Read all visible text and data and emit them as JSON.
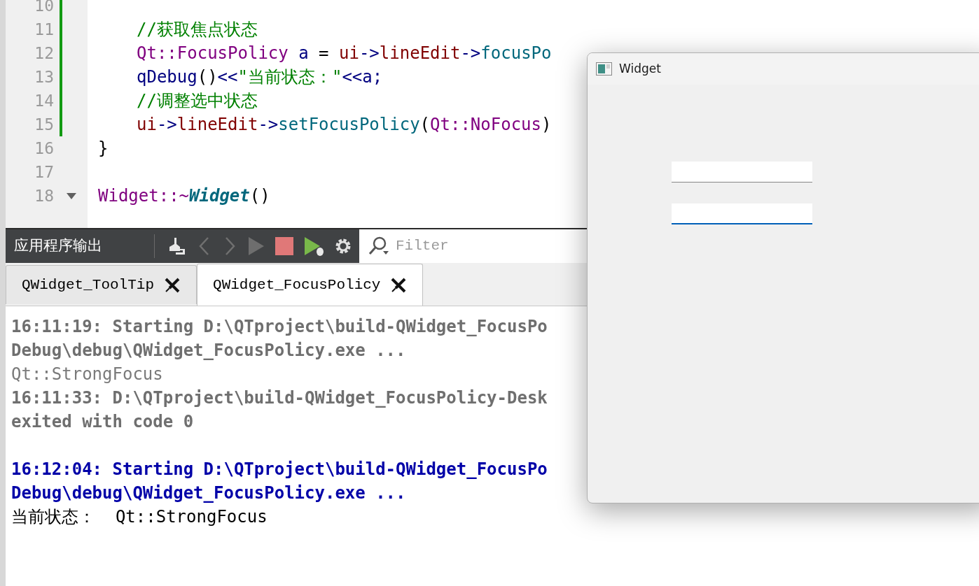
{
  "editor": {
    "lines": [
      {
        "number": "10",
        "changed": true
      },
      {
        "number": "11",
        "changed": true,
        "indented": true,
        "tokens": [
          {
            "kind": "comment",
            "text": "//获取焦点状态"
          }
        ]
      },
      {
        "number": "12",
        "changed": true,
        "indented": true,
        "tokens": [
          {
            "kind": "type",
            "text": "Qt::FocusPolicy"
          },
          {
            "kind": "local",
            "text": " a"
          },
          {
            "kind": "plain",
            "text": " = "
          },
          {
            "kind": "member",
            "text": "ui"
          },
          {
            "kind": "local",
            "text": "->"
          },
          {
            "kind": "member",
            "text": "lineEdit"
          },
          {
            "kind": "local",
            "text": "->"
          },
          {
            "kind": "func",
            "text": "focusPo"
          }
        ]
      },
      {
        "number": "13",
        "changed": true,
        "indented": true,
        "tokens": [
          {
            "kind": "local",
            "text": "qDebug"
          },
          {
            "kind": "plain",
            "text": "()"
          },
          {
            "kind": "local",
            "text": "<<"
          },
          {
            "kind": "string",
            "text": "\"当前状态：\""
          },
          {
            "kind": "local",
            "text": "<<a;"
          }
        ]
      },
      {
        "number": "14",
        "changed": true,
        "indented": true,
        "tokens": [
          {
            "kind": "comment",
            "text": "//调整选中状态"
          }
        ]
      },
      {
        "number": "15",
        "changed": true,
        "indented": true,
        "tokens": [
          {
            "kind": "member",
            "text": "ui"
          },
          {
            "kind": "local",
            "text": "->"
          },
          {
            "kind": "member",
            "text": "lineEdit"
          },
          {
            "kind": "local",
            "text": "->"
          },
          {
            "kind": "func",
            "text": "setFocusPolicy"
          },
          {
            "kind": "plain",
            "text": "("
          },
          {
            "kind": "type",
            "text": "Qt::NoFocus"
          },
          {
            "kind": "plain",
            "text": ")"
          }
        ]
      },
      {
        "number": "16",
        "changed": false,
        "indented": false,
        "tokens": [
          {
            "kind": "plain",
            "text": "}"
          }
        ]
      },
      {
        "number": "17",
        "changed": false
      },
      {
        "number": "18",
        "changed": false,
        "foldable": true,
        "indented": false,
        "tokens": [
          {
            "kind": "type",
            "text": "Widget::~"
          },
          {
            "kind": "decl",
            "text": "Widget"
          },
          {
            "kind": "plain",
            "text": "()"
          }
        ]
      }
    ]
  },
  "output_pane": {
    "title": "应用程序输出",
    "filter": {
      "placeholder": "Filter"
    },
    "tabs": [
      {
        "label": "QWidget_ToolTip",
        "selected": false
      },
      {
        "label": "QWidget_FocusPolicy",
        "selected": true
      }
    ],
    "lines": [
      {
        "kind": "system",
        "text": "16:11:19: Starting D:\\QTproject\\build-QWidget_FocusPo"
      },
      {
        "kind": "system",
        "text": "Debug\\debug\\QWidget_FocusPolicy.exe ..."
      },
      {
        "kind": "old_output",
        "text": "Qt::StrongFocus"
      },
      {
        "kind": "system",
        "text": "16:11:33: D:\\QTproject\\build-QWidget_FocusPolicy-Desk"
      },
      {
        "kind": "system",
        "text": "exited with code 0"
      },
      {
        "kind": "blank"
      },
      {
        "kind": "start",
        "text": "16:12:04: Starting D:\\QTproject\\build-QWidget_FocusPo"
      },
      {
        "kind": "start",
        "text": "Debug\\debug\\QWidget_FocusPolicy.exe ..."
      },
      {
        "kind": "output",
        "text": "当前状态：  Qt::StrongFocus"
      }
    ]
  },
  "widget_window": {
    "title": "Widget",
    "fields": [
      {
        "focused": false
      },
      {
        "focused": true
      }
    ]
  }
}
